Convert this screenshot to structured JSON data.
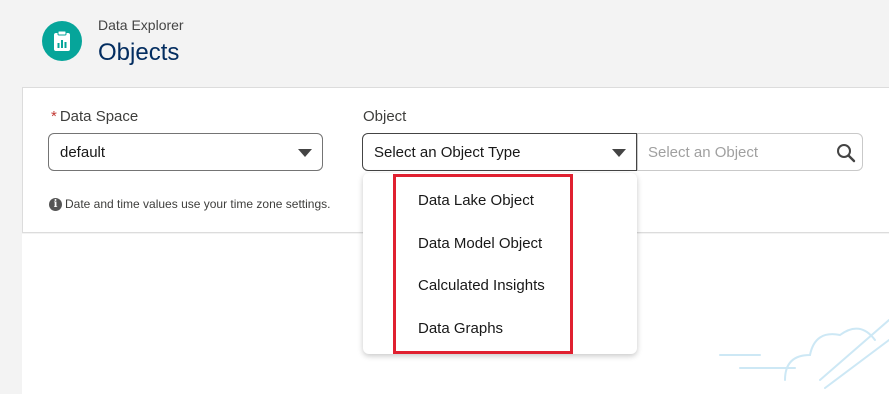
{
  "header": {
    "eyebrow": "Data Explorer",
    "title": "Objects",
    "icon": "data-explorer-icon"
  },
  "form": {
    "data_space": {
      "label": "Data Space",
      "required_marker": "*",
      "value": "default"
    },
    "object": {
      "label": "Object",
      "type_value": "Select an Object Type",
      "object_placeholder": "Select an Object"
    },
    "info_text": "Date and time values use your time zone settings."
  },
  "dropdown": {
    "options": [
      "Data Lake Object",
      "Data Model Object",
      "Calculated Insights",
      "Data Graphs"
    ]
  },
  "colors": {
    "brand_icon": "#06a59a",
    "title": "#032d60",
    "highlight": "#e02030",
    "required": "#c23934"
  }
}
